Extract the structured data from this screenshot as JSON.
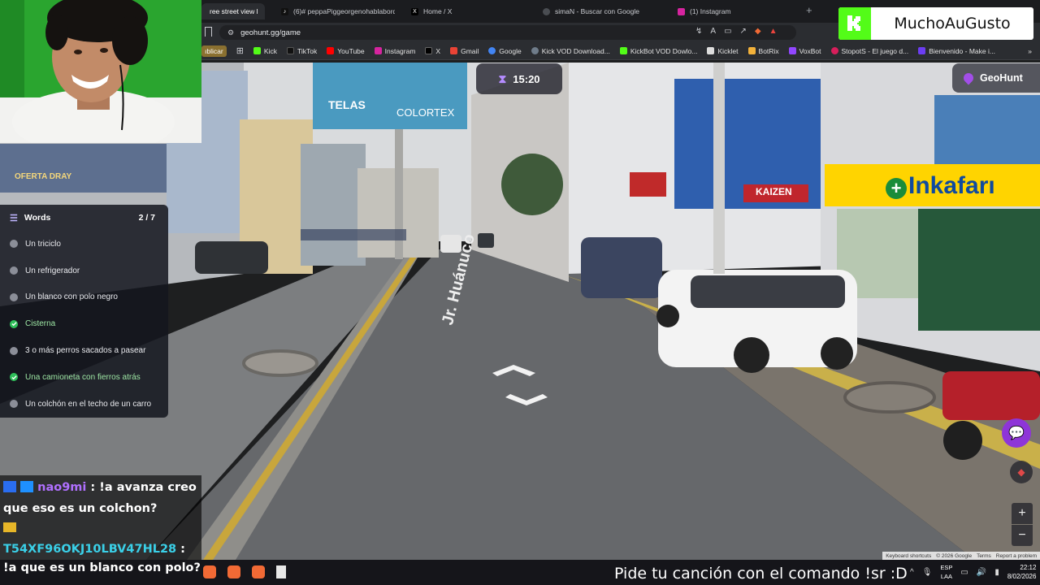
{
  "browser": {
    "tabs": [
      {
        "label": "ree street view l",
        "icon": "streetview-tab-icon",
        "active": true
      },
      {
        "label": "(6)# peppaPiggeorgenohablaborq",
        "icon": "tiktok-tab-icon"
      },
      {
        "label": "Home / X",
        "icon": "x-tab-icon"
      },
      {
        "label": "simaN - Buscar con Google",
        "icon": "google-tab-icon"
      },
      {
        "label": "(1) Instagram",
        "icon": "instagram-tab-icon"
      }
    ],
    "url": "geohunt.gg/game",
    "bookmarks": [
      {
        "label": "ıblicar",
        "color": "#8a7030"
      },
      {
        "label": "Kick",
        "color": "#53fc18"
      },
      {
        "label": "TikTok",
        "color": "#111111"
      },
      {
        "label": "YouTube",
        "color": "#ff0000"
      },
      {
        "label": "Instagram",
        "color": "#d6249f"
      },
      {
        "label": "X",
        "color": "#000000"
      },
      {
        "label": "Gmail",
        "color": "#ea4335"
      },
      {
        "label": "Google",
        "color": "#4285f4"
      },
      {
        "label": "Kick VOD Download...",
        "color": "#6f7c8a"
      },
      {
        "label": "KickBot VOD Dowlo...",
        "color": "#53fc18"
      },
      {
        "label": "Kicklet",
        "color": "#dddddd"
      },
      {
        "label": "BotRix",
        "color": "#f2b13a"
      },
      {
        "label": "VoxBot",
        "color": "#9146ff"
      },
      {
        "label": "StopotS - El juego d...",
        "color": "#d81e5b"
      },
      {
        "label": "Bienvenido - Make i...",
        "color": "#6c3df2"
      }
    ]
  },
  "overlay": {
    "kick_channel": "MuchoAuGusto",
    "song_request": "Pide tu canción con el comando !sr :D"
  },
  "game": {
    "brand": "GeoHunt",
    "timer": "15:20",
    "street_label": "Jr. Huánuco",
    "sign_colortex": "COLORTEX",
    "sign_telas": "TELAS",
    "sign_oferta": "OFERTA DRAY",
    "sign_inkafarma": "Inkafarı",
    "sign_kaizen": "KAIZEN",
    "words_title": "Words",
    "words_progress": "2 / 7",
    "words": [
      {
        "label": "Un triciclo",
        "done": false
      },
      {
        "label": "Un refrigerador",
        "done": false
      },
      {
        "label": "Un blanco con polo negro",
        "done": false
      },
      {
        "label": "Cisterna",
        "done": true
      },
      {
        "label": "3 o más perros sacados a pasear",
        "done": false
      },
      {
        "label": "Una camioneta con fierros atrás",
        "done": true
      },
      {
        "label": "Un colchón en el techo de un carro",
        "done": false
      }
    ],
    "attribution": [
      "Keyboard shortcuts",
      "© 2026 Google",
      "Terms",
      "Report a problem"
    ]
  },
  "chat": [
    {
      "user": "nao9mi",
      "message": "!a avanza creo que eso es un colchon?"
    },
    {
      "user": "T54XF96OKJ10LBV47HL28",
      "message": "!a que es un blanco con polo?"
    }
  ],
  "taskbar": {
    "lang_1": "ESP",
    "lang_2": "LAA",
    "time": "22:12",
    "date": "8/02/2026"
  }
}
